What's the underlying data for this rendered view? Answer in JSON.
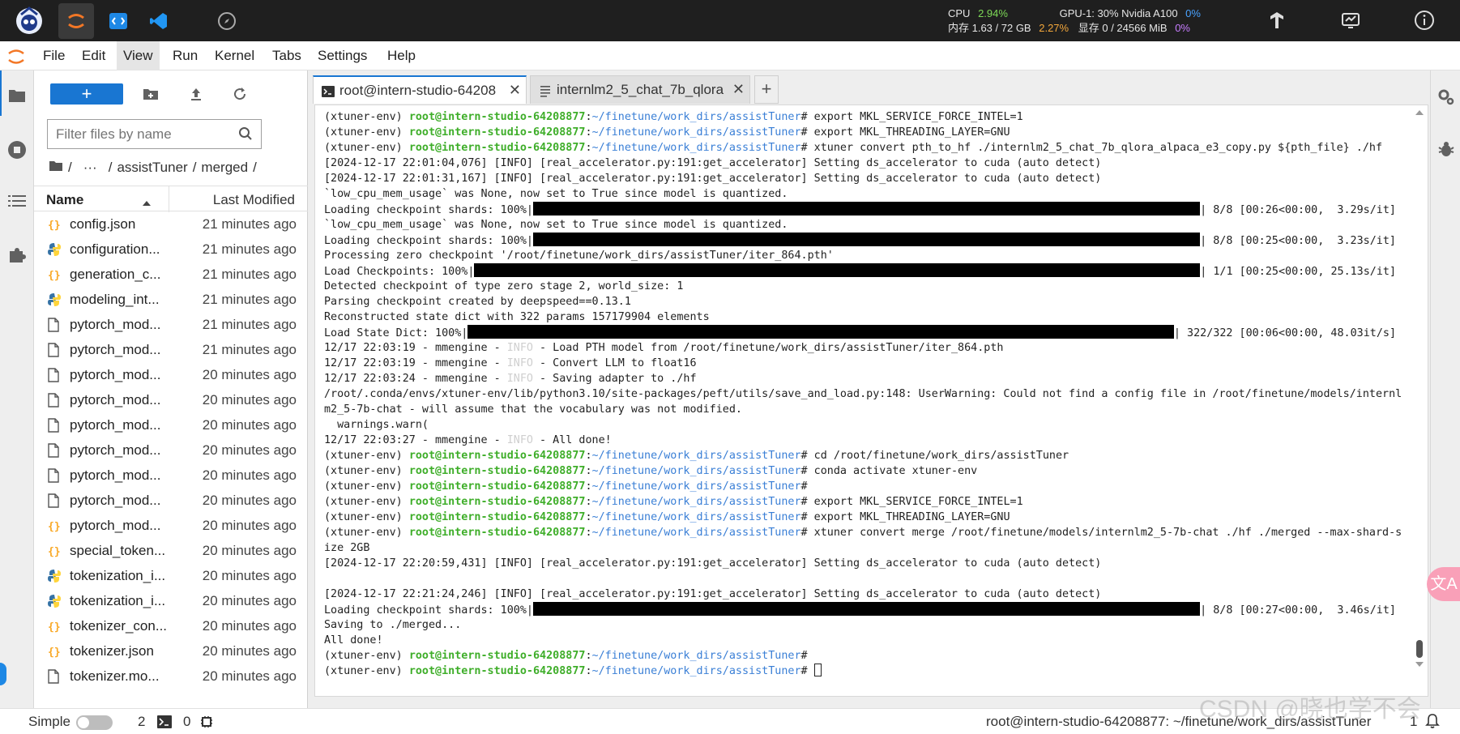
{
  "topbar": {
    "cpu_label": "CPU",
    "cpu_value": "2.94%",
    "mem_label": "内存 1.63 / 72 GB",
    "mem_value": "2.27%",
    "gpu_label": "GPU-1: 30% Nvidia A100",
    "gpu_value": "0%",
    "vram_label": "显存 0 / 24566 MiB",
    "vram_value": "0%"
  },
  "menu": {
    "items": [
      "File",
      "Edit",
      "View",
      "Run",
      "Kernel",
      "Tabs",
      "Settings",
      "Help"
    ],
    "active": "View"
  },
  "filebrowser": {
    "new_label": "+",
    "filter_placeholder": "Filter files by name",
    "breadcrumb": {
      "root": "/",
      "ellipsis": "···",
      "sep1": "/",
      "folder1": "assistTuner",
      "sep2": "/",
      "folder2": "merged",
      "sep3": "/"
    },
    "col_name": "Name",
    "col_modified": "Last Modified",
    "files": [
      {
        "name": "config.json",
        "icon": "json-icon",
        "modified": "21 minutes ago"
      },
      {
        "name": "configuration...",
        "icon": "python-icon",
        "modified": "21 minutes ago"
      },
      {
        "name": "generation_c...",
        "icon": "json-icon",
        "modified": "21 minutes ago"
      },
      {
        "name": "modeling_int...",
        "icon": "python-icon",
        "modified": "21 minutes ago"
      },
      {
        "name": "pytorch_mod...",
        "icon": "file-icon",
        "modified": "21 minutes ago"
      },
      {
        "name": "pytorch_mod...",
        "icon": "file-icon",
        "modified": "21 minutes ago"
      },
      {
        "name": "pytorch_mod...",
        "icon": "file-icon",
        "modified": "20 minutes ago"
      },
      {
        "name": "pytorch_mod...",
        "icon": "file-icon",
        "modified": "20 minutes ago"
      },
      {
        "name": "pytorch_mod...",
        "icon": "file-icon",
        "modified": "20 minutes ago"
      },
      {
        "name": "pytorch_mod...",
        "icon": "file-icon",
        "modified": "20 minutes ago"
      },
      {
        "name": "pytorch_mod...",
        "icon": "file-icon",
        "modified": "20 minutes ago"
      },
      {
        "name": "pytorch_mod...",
        "icon": "file-icon",
        "modified": "20 minutes ago"
      },
      {
        "name": "pytorch_mod...",
        "icon": "json-icon",
        "modified": "20 minutes ago"
      },
      {
        "name": "special_token...",
        "icon": "json-icon",
        "modified": "20 minutes ago"
      },
      {
        "name": "tokenization_i...",
        "icon": "python-icon",
        "modified": "20 minutes ago"
      },
      {
        "name": "tokenization_i...",
        "icon": "python-icon",
        "modified": "20 minutes ago"
      },
      {
        "name": "tokenizer_con...",
        "icon": "json-icon",
        "modified": "20 minutes ago"
      },
      {
        "name": "tokenizer.json",
        "icon": "json-icon",
        "modified": "20 minutes ago"
      },
      {
        "name": "tokenizer.mo...",
        "icon": "file-icon",
        "modified": "20 minutes ago"
      }
    ]
  },
  "tabs": [
    {
      "label": "root@intern-studio-64208",
      "icon": "terminal-icon",
      "active": true
    },
    {
      "label": "internlm2_5_chat_7b_qlora",
      "icon": "text-file-icon",
      "active": false
    }
  ],
  "terminal": {
    "env": "(xtuner-env)",
    "host": "root@intern-studio-64208877",
    "path": "~/finetune/work_dirs/assistTuner",
    "info": "INFO",
    "lines": [
      {
        "kind": "prompt",
        "cmd": "export MKL_SERVICE_FORCE_INTEL=1"
      },
      {
        "kind": "prompt",
        "cmd": "export MKL_THREADING_LAYER=GNU"
      },
      {
        "kind": "prompt",
        "cmd": "xtuner convert pth_to_hf ./internlm2_5_chat_7b_qlora_alpaca_e3_copy.py ${pth_file} ./hf"
      },
      {
        "kind": "text",
        "text": "[2024-12-17 22:01:04,076] [INFO] [real_accelerator.py:191:get_accelerator] Setting ds_accelerator to cuda (auto detect)"
      },
      {
        "kind": "text",
        "text": "[2024-12-17 22:01:31,167] [INFO] [real_accelerator.py:191:get_accelerator] Setting ds_accelerator to cuda (auto detect)"
      },
      {
        "kind": "text",
        "text": "`low_cpu_mem_usage` was None, now set to True since model is quantized."
      },
      {
        "kind": "bar",
        "pre": "Loading checkpoint shards: 100%|",
        "post": "| 8/8 [00:26<00:00,  3.29s/it]",
        "progress": 1.0
      },
      {
        "kind": "text",
        "text": "`low_cpu_mem_usage` was None, now set to True since model is quantized."
      },
      {
        "kind": "bar",
        "pre": "Loading checkpoint shards: 100%|",
        "post": "| 8/8 [00:25<00:00,  3.23s/it]",
        "progress": 1.0
      },
      {
        "kind": "text",
        "text": "Processing zero checkpoint '/root/finetune/work_dirs/assistTuner/iter_864.pth'"
      },
      {
        "kind": "bar",
        "pre": "Load Checkpoints: 100%|",
        "post": "| 1/1 [00:25<00:00, 25.13s/it]",
        "progress": 1.0
      },
      {
        "kind": "text",
        "text": "Detected checkpoint of type zero stage 2, world_size: 1"
      },
      {
        "kind": "text",
        "text": "Parsing checkpoint created by deepspeed==0.13.1"
      },
      {
        "kind": "text",
        "text": "Reconstructed state dict with 322 params 157179904 elements"
      },
      {
        "kind": "bar",
        "pre": "Load State Dict: 100%|",
        "post": "| 322/322 [00:06<00:00, 48.03it/s]",
        "progress": 1.0
      },
      {
        "kind": "info",
        "pre": "12/17 22:03:19 - mmengine - ",
        "post": " - Load PTH model from /root/finetune/work_dirs/assistTuner/iter_864.pth"
      },
      {
        "kind": "info",
        "pre": "12/17 22:03:19 - mmengine - ",
        "post": " - Convert LLM to float16"
      },
      {
        "kind": "info",
        "pre": "12/17 22:03:24 - mmengine - ",
        "post": " - Saving adapter to ./hf"
      },
      {
        "kind": "text",
        "text": "/root/.conda/envs/xtuner-env/lib/python3.10/site-packages/peft/utils/save_and_load.py:148: UserWarning: Could not find a config file in /root/finetune/models/internl"
      },
      {
        "kind": "text",
        "text": "m2_5-7b-chat - will assume that the vocabulary was not modified."
      },
      {
        "kind": "text",
        "text": "  warnings.warn("
      },
      {
        "kind": "info",
        "pre": "12/17 22:03:27 - mmengine - ",
        "post": " - All done!"
      },
      {
        "kind": "prompt",
        "cmd": "cd /root/finetune/work_dirs/assistTuner"
      },
      {
        "kind": "prompt",
        "cmd": "conda activate xtuner-env"
      },
      {
        "kind": "prompt",
        "cmd": ""
      },
      {
        "kind": "prompt",
        "cmd": "export MKL_SERVICE_FORCE_INTEL=1"
      },
      {
        "kind": "prompt",
        "cmd": "export MKL_THREADING_LAYER=GNU"
      },
      {
        "kind": "prompt",
        "cmd": "xtuner convert merge /root/finetune/models/internlm2_5-7b-chat ./hf ./merged --max-shard-s"
      },
      {
        "kind": "text",
        "text": "ize 2GB"
      },
      {
        "kind": "text",
        "text": "[2024-12-17 22:20:59,431] [INFO] [real_accelerator.py:191:get_accelerator] Setting ds_accelerator to cuda (auto detect)"
      },
      {
        "kind": "text",
        "text": ""
      },
      {
        "kind": "text",
        "text": "[2024-12-17 22:21:24,246] [INFO] [real_accelerator.py:191:get_accelerator] Setting ds_accelerator to cuda (auto detect)"
      },
      {
        "kind": "bar",
        "pre": "Loading checkpoint shards: 100%|",
        "post": "| 8/8 [00:27<00:00,  3.46s/it]",
        "progress": 1.0
      },
      {
        "kind": "text",
        "text": "Saving to ./merged..."
      },
      {
        "kind": "text",
        "text": "All done!"
      },
      {
        "kind": "prompt",
        "cmd": ""
      },
      {
        "kind": "prompt",
        "cmd": "",
        "cursor": true
      }
    ]
  },
  "statusbar": {
    "mode": "Simple",
    "kernels": "2",
    "terminals": "0",
    "path": "root@intern-studio-64208877: ~/finetune/work_dirs/assistTuner",
    "notif_count": "1"
  },
  "watermark": "CSDN @晓也学不会",
  "colors": {
    "accent": "#1976d2",
    "prompt_green": "#3fae2a",
    "path_blue": "#3a7fd6",
    "topbar": "#1f1f1f"
  }
}
